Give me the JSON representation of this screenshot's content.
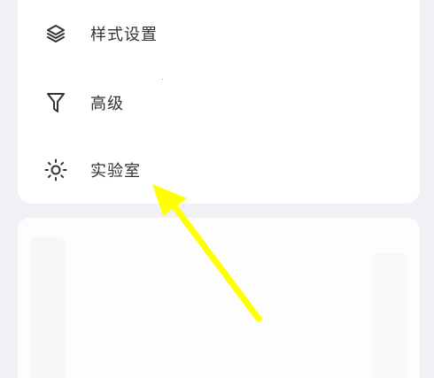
{
  "menu": {
    "items": [
      {
        "label": "样式设置",
        "icon": "layers-icon"
      },
      {
        "label": "高级",
        "icon": "filter-icon"
      },
      {
        "label": "实验室",
        "icon": "sun-icon"
      }
    ]
  },
  "annotation": {
    "arrow_color": "#ffff00"
  }
}
